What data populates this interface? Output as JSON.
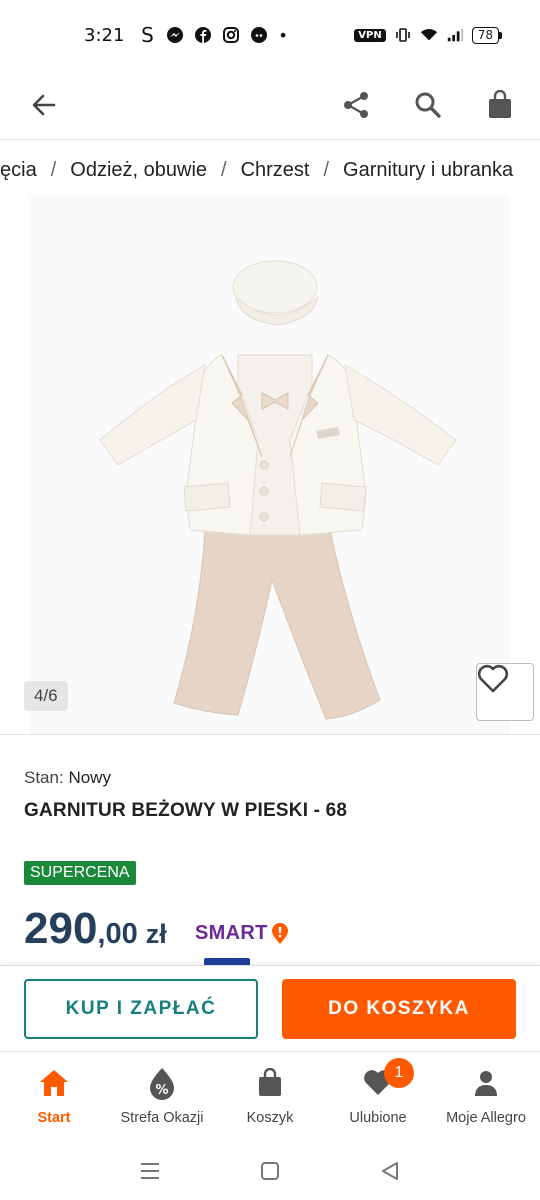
{
  "status_bar": {
    "time": "3:21",
    "s_glyph": "S",
    "dot": "•",
    "vpn": "VPN",
    "battery": "78",
    "icons": [
      "messenger-icon",
      "facebook-icon",
      "instagram-icon",
      "discord-icon",
      "vibrate-icon",
      "wifi-icon",
      "signal-icon"
    ]
  },
  "header": {
    "icons": [
      "back-arrow-icon",
      "share-icon",
      "search-icon",
      "shopping-bag-icon"
    ]
  },
  "breadcrumb": {
    "items": [
      "ęcia",
      "Odzież, obuwie",
      "Chrzest",
      "Garnitury i ubranka"
    ],
    "separator": "/"
  },
  "gallery": {
    "counter": "4/6",
    "favorite_icon": "heart-outline-icon"
  },
  "product": {
    "condition_label": "Stan:",
    "condition_value": "Nowy",
    "title": "GARNITUR BEŻOWY W PIESKI - 68",
    "badge": "SUPERCENA",
    "price_int": "290",
    "price_dec": ",00",
    "currency": "zł",
    "smart": "SMART"
  },
  "actions": {
    "buy": "KUP I ZAPŁAĆ",
    "cart": "DO KOSZYKA"
  },
  "bottom_nav": {
    "items": [
      {
        "label": "Start",
        "icon": "home-icon"
      },
      {
        "label": "Strefa Okazji",
        "icon": "discount-icon"
      },
      {
        "label": "Koszyk",
        "icon": "bag-icon"
      },
      {
        "label": "Ulubione",
        "icon": "heart-icon"
      },
      {
        "label": "Moje Allegro",
        "icon": "user-icon"
      }
    ],
    "favorites_badge": "1"
  },
  "colors": {
    "accent": "#ff5a00",
    "teal": "#17807d",
    "price": "#26405c",
    "supercena": "#1a8a3a",
    "smart": "#6b2a9a"
  }
}
